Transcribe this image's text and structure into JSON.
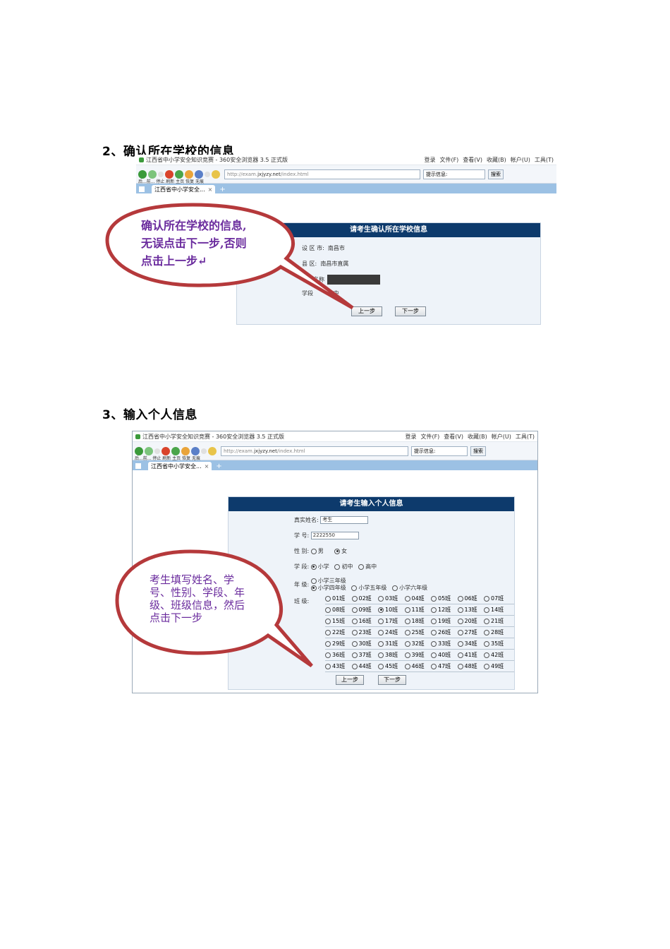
{
  "doc": {
    "step2_heading": "2、确认所在学校的信息",
    "step3_heading": "3、输入个人信息"
  },
  "browser": {
    "window_title_1": "江西省中小学安全知识竞赛 - 360安全浏览器 3.5 正式版",
    "window_title_2": "江西省中小学安全知识竞赛 - 360安全浏览器 3.5 正式版",
    "menu_login": "登录",
    "menu_file": "文件(F)",
    "menu_view": "查看(V)",
    "menu_fav": "收藏(B)",
    "menu_account": "帐户(U)",
    "menu_tools": "工具(T)",
    "nav_labels": "后...前... 停止 刷新 主页 恢复    无痕",
    "url_prefix": "http://exam.",
    "url_domain": "jxjyzy.net",
    "url_suffix": "/index.html",
    "search_placeholder": "提示信息:",
    "search_button": "搜索",
    "tab_label": "江西省中小学安全...",
    "tab_close": "×",
    "tab_plus": "+"
  },
  "school_confirm": {
    "panel_title": "请考生确认所在学校信息",
    "city_label": "设 区 市:",
    "city_value": "南昌市",
    "county_label": "县    区:",
    "county_value": "南昌市直属",
    "school_label": "学校名称",
    "stage_label": "学段",
    "stage_value": "初中",
    "prev_button": "上一步",
    "next_button": "下一步",
    "callout": "确认所在学校的信息,无误点击下一步,否则点击上一步↵"
  },
  "personal_info": {
    "panel_title": "请考生输入个人信息",
    "name_label": "真实姓名:",
    "name_value": "考生",
    "id_label": "学    号:",
    "id_value": "2222550",
    "gender_label": "性    别:",
    "gender_male": "男",
    "gender_female": "女",
    "stage_label": "学    段:",
    "stage_primary": "小学",
    "stage_middle": "初中",
    "stage_high": "高中",
    "grade_label": "年    级:",
    "grade_options": [
      "小学三年级",
      "小学四年级",
      "小学五年级",
      "小学六年级"
    ],
    "class_label": "班    级:",
    "classes": [
      [
        "01班",
        "02班",
        "03班",
        "04班",
        "05班",
        "06班",
        "07班"
      ],
      [
        "08班",
        "09班",
        "10班",
        "11班",
        "12班",
        "13班",
        "14班"
      ],
      [
        "15班",
        "16班",
        "17班",
        "18班",
        "19班",
        "20班",
        "21班"
      ],
      [
        "22班",
        "23班",
        "24班",
        "25班",
        "26班",
        "27班",
        "28班"
      ],
      [
        "29班",
        "30班",
        "31班",
        "32班",
        "33班",
        "34班",
        "35班"
      ],
      [
        "36班",
        "37班",
        "38班",
        "39班",
        "40班",
        "41班",
        "42班"
      ],
      [
        "43班",
        "44班",
        "45班",
        "46班",
        "47班",
        "48班",
        "49班"
      ]
    ],
    "prev_button": "上一步",
    "next_button": "下一步",
    "callout": "考生填写姓名、学号、性别、学段、年级、班级信息，然后点击下一步"
  },
  "colors": {
    "panel_header": "#0d3a6c",
    "callout_border": "#b5393b",
    "callout_text": "#6a2b9d",
    "tabbar": "#9cc1e4"
  }
}
